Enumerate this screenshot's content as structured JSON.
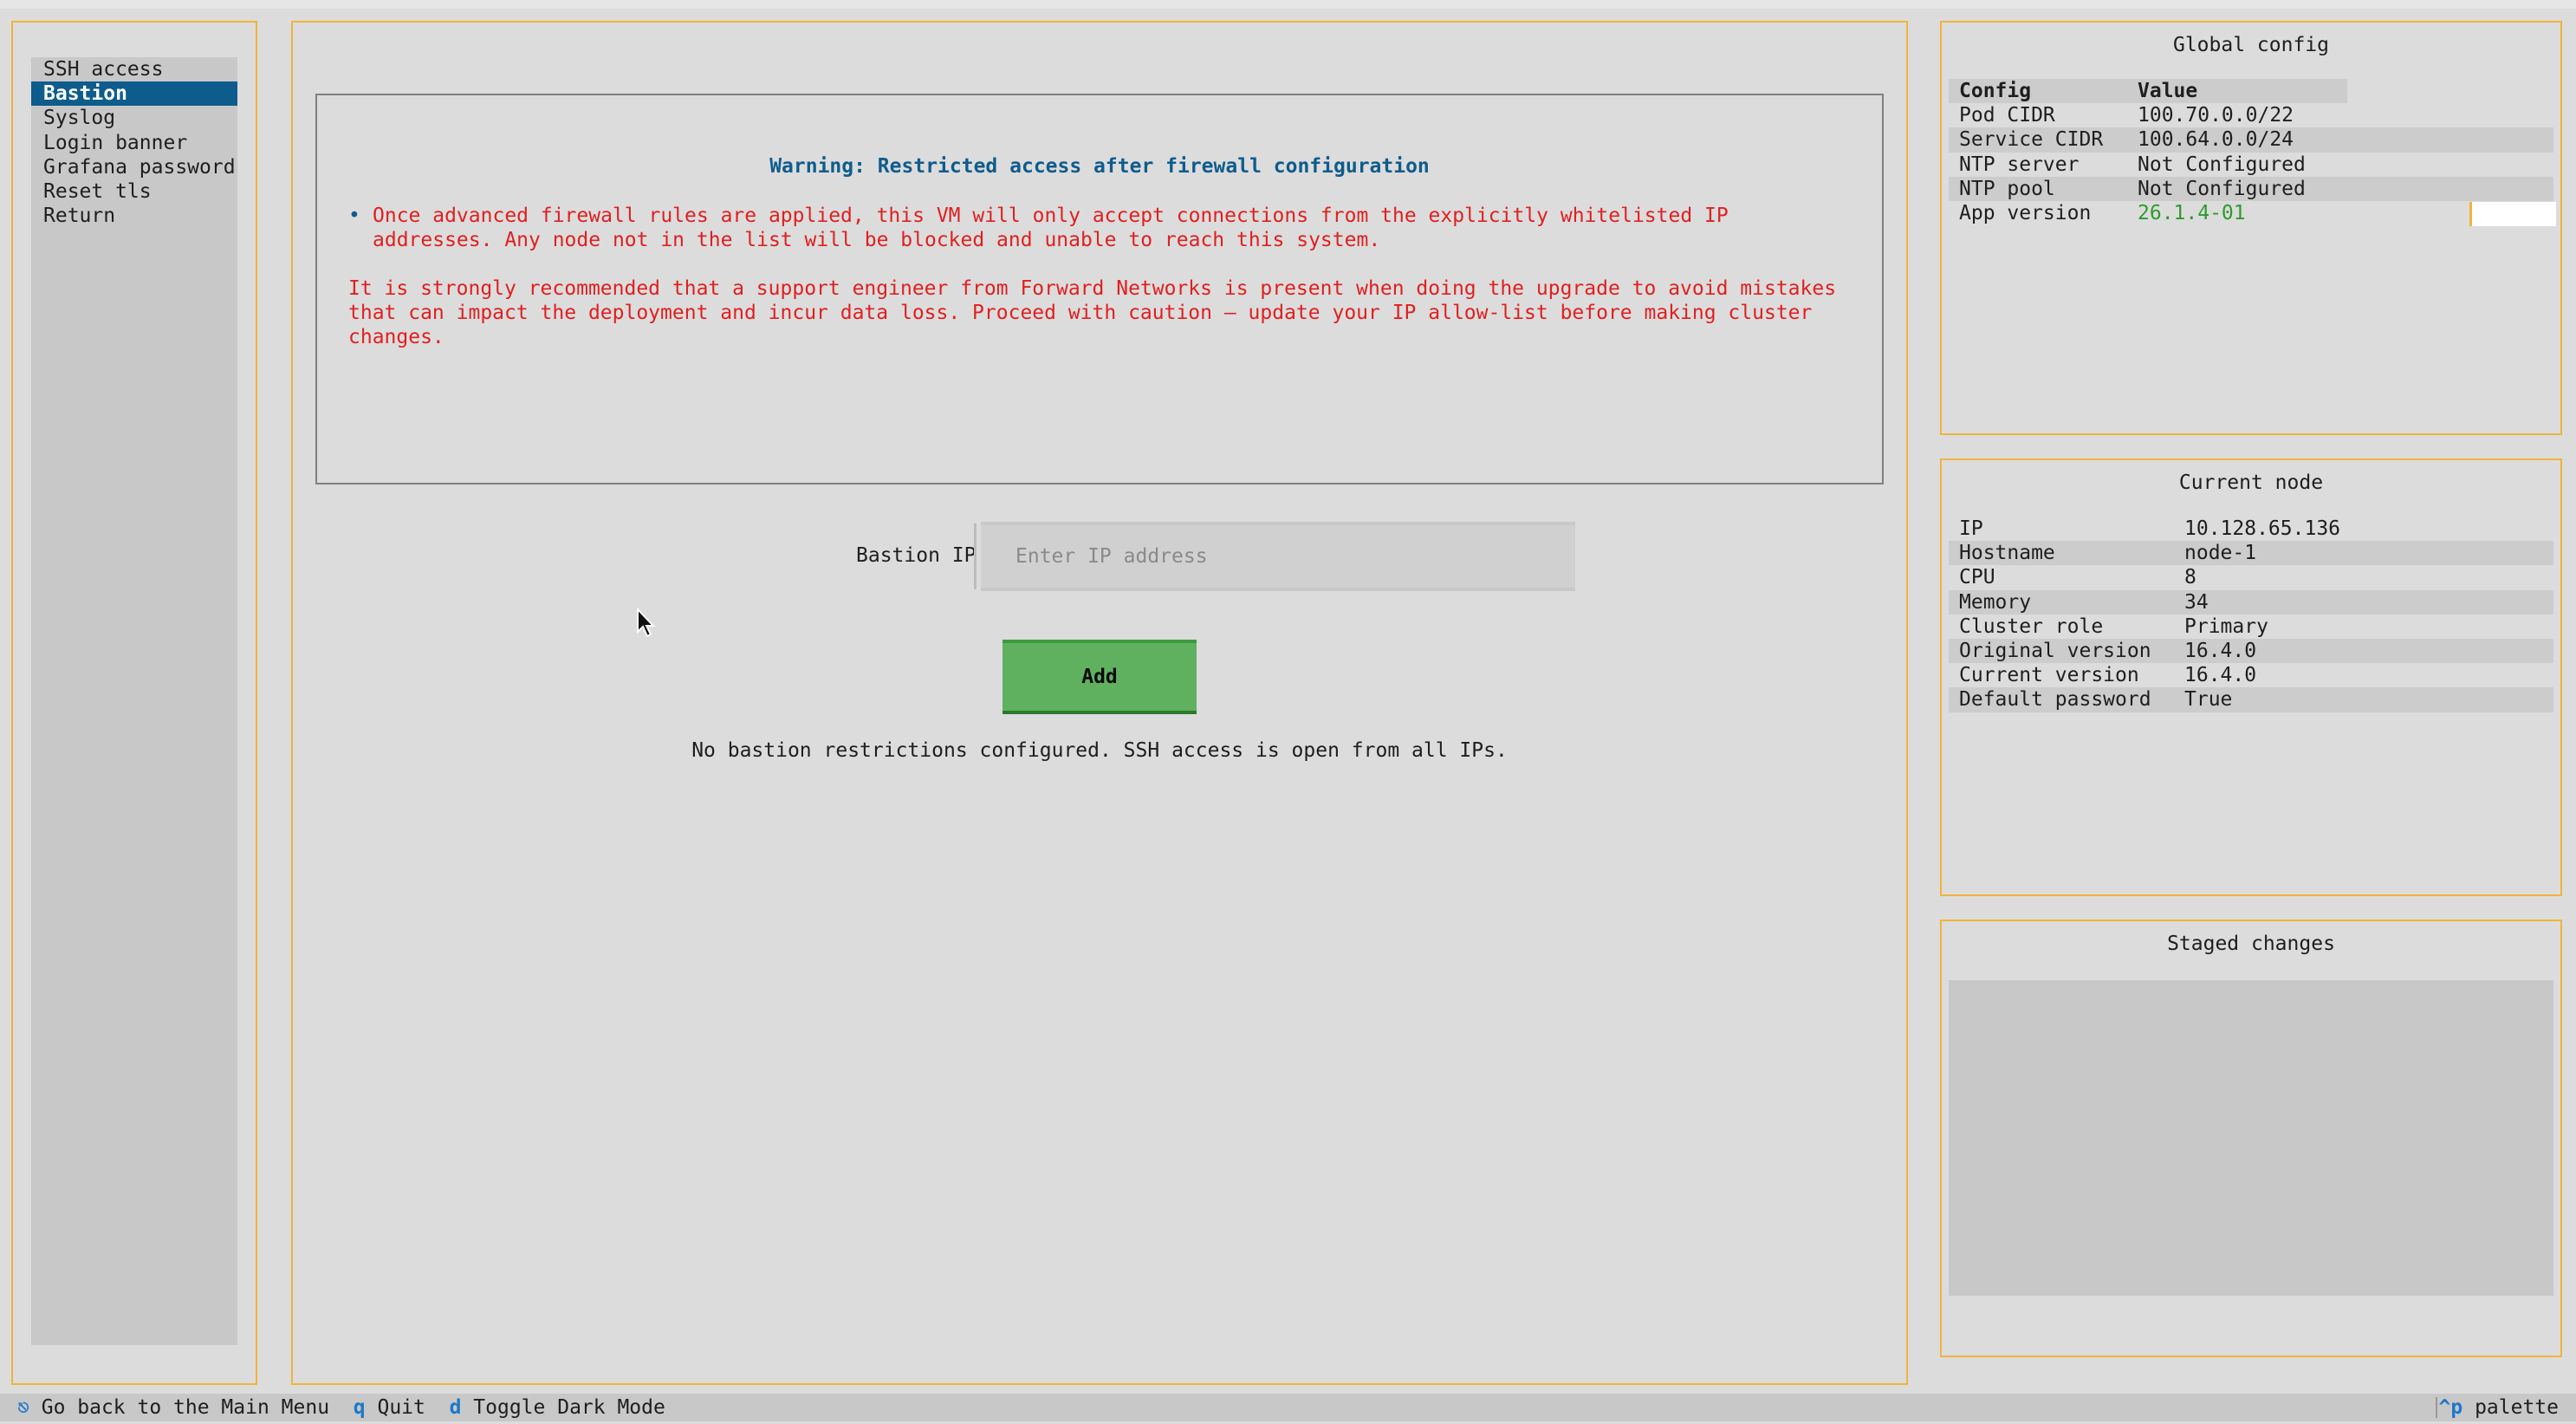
{
  "sidebar": {
    "items": [
      {
        "label": "SSH access",
        "active": false
      },
      {
        "label": "Bastion",
        "active": true
      },
      {
        "label": "Syslog",
        "active": false
      },
      {
        "label": "Login banner",
        "active": false
      },
      {
        "label": "Grafana password",
        "active": false
      },
      {
        "label": "Reset tls",
        "active": false
      },
      {
        "label": "Return",
        "active": false
      }
    ]
  },
  "warning": {
    "title": "Warning: Restricted access after firewall configuration",
    "bullet": "Once advanced firewall rules are applied, this VM will only accept connections from the explicitly whitelisted IP addresses. Any node not in the list will be blocked and unable to reach this system.",
    "paragraph": "It is strongly recommended that a support engineer from Forward Networks is present when doing the upgrade to avoid mistakes that can impact the deployment and incur data loss. Proceed with caution — update your IP allow-list before making cluster changes."
  },
  "bastion": {
    "label": "Bastion IP",
    "placeholder": "Enter IP address",
    "value": "",
    "add_label": "Add",
    "status": "No bastion restrictions configured. SSH access is open from all IPs."
  },
  "global_config": {
    "title": "Global config",
    "headers": [
      "Config",
      "Value"
    ],
    "rows": [
      [
        "Pod CIDR",
        "100.70.0.0/22"
      ],
      [
        "Service CIDR",
        "100.64.0.0/24"
      ],
      [
        "NTP server",
        "Not Configured"
      ],
      [
        "NTP pool",
        "Not Configured"
      ],
      [
        "App version",
        "26.1.4-01"
      ]
    ]
  },
  "current_node": {
    "title": "Current node",
    "rows": [
      [
        "IP",
        "10.128.65.136"
      ],
      [
        "Hostname",
        "node-1"
      ],
      [
        "CPU",
        "8"
      ],
      [
        "Memory",
        "34"
      ],
      [
        "Cluster role",
        "Primary"
      ],
      [
        "Original version",
        "16.4.0"
      ],
      [
        "Current version",
        "16.4.0"
      ],
      [
        "Default password",
        "True"
      ]
    ]
  },
  "staged_changes": {
    "title": "Staged changes"
  },
  "footer": {
    "back_key": "⎋",
    "back_label": "Go back to the Main Menu",
    "quit_key": "q",
    "quit_label": "Quit",
    "dark_key": "d",
    "dark_label": "Toggle Dark Mode",
    "palette_key": "^p",
    "palette_label": "palette"
  },
  "colors": {
    "accent_border": "#f0b43c",
    "active_item_bg": "#0e5c8c",
    "warning_text": "#e02020",
    "add_button": "#5fb160",
    "version_text": "#2e9a2e"
  }
}
